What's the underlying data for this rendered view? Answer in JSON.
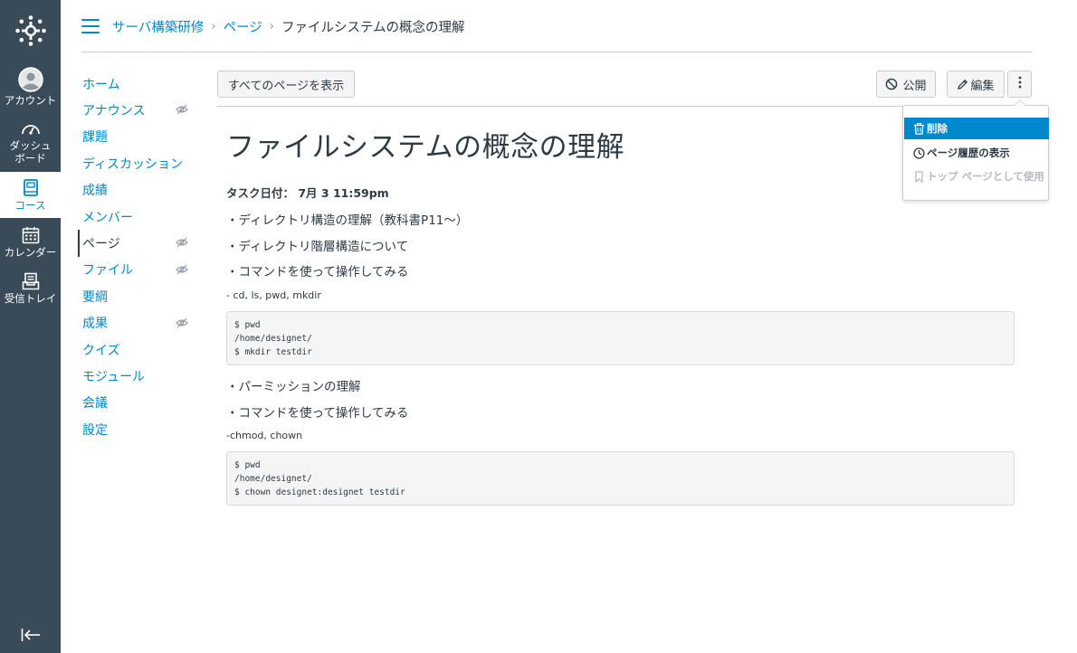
{
  "global_nav": {
    "account": "アカウント",
    "dashboard_1": "ダッシュ",
    "dashboard_2": "ボード",
    "courses": "コース",
    "calendar": "カレンダー",
    "inbox": "受信トレイ"
  },
  "breadcrumb": {
    "course": "サーバ構築研修",
    "pages": "ページ",
    "current": "ファイルシステムの概念の理解"
  },
  "course_nav": [
    {
      "label": "ホーム"
    },
    {
      "label": "アナウンス"
    },
    {
      "label": "課題"
    },
    {
      "label": "ディスカッション"
    },
    {
      "label": "成績"
    },
    {
      "label": "メンバー"
    },
    {
      "label": "ページ"
    },
    {
      "label": "ファイル"
    },
    {
      "label": "要綱"
    },
    {
      "label": "成果"
    },
    {
      "label": "クイズ"
    },
    {
      "label": "モジュール"
    },
    {
      "label": "会議"
    },
    {
      "label": "設定"
    }
  ],
  "toolbar": {
    "all_pages": "すべてのページを表示",
    "publish": "公開",
    "edit": "編集"
  },
  "menu": {
    "delete": "削除",
    "history": "ページ履歴の表示",
    "front_page": "トップ ページとして使用"
  },
  "page": {
    "title": "ファイルシステムの概念の理解",
    "due": "タスク日付： 7月 3 11:59pm",
    "line1": "・ディレクトリ構造の理解（教科書P11～）",
    "line2": "・ディレクトリ階層構造について",
    "line3": "・コマンドを使って操作してみる",
    "cmds1": "- cd, ls, pwd, mkdir",
    "code1": "$ pwd\n/home/designet/\n$ mkdir testdir",
    "line4": "・パーミッションの理解",
    "line5": "・コマンドを使って操作してみる",
    "cmds2": "-chmod, chown",
    "code2": "$ pwd\n/home/designet/\n$ chown designet:designet testdir"
  },
  "colors": {
    "nav_bg": "#394b58",
    "link": "#0088cc",
    "text": "#2d3b45",
    "menu_active": "#0088cc"
  }
}
